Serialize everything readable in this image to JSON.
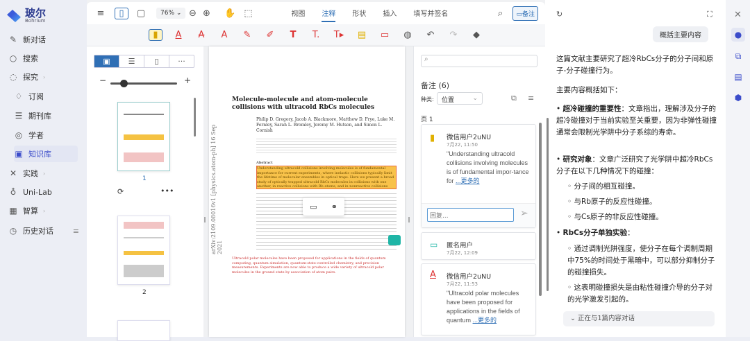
{
  "brand": {
    "name": "玻尔",
    "sub": "Bohrium"
  },
  "sidebar": {
    "items": [
      {
        "label": "新对话",
        "icon": "edit-icon"
      },
      {
        "label": "搜索",
        "icon": "search-icon"
      },
      {
        "label": "探究",
        "icon": "planet-icon"
      },
      {
        "label": "订阅",
        "icon": "bell-icon"
      },
      {
        "label": "期刊库",
        "icon": "journal-icon"
      },
      {
        "label": "学者",
        "icon": "scholar-icon"
      },
      {
        "label": "知识库",
        "icon": "book-icon"
      },
      {
        "label": "实践",
        "icon": "tools-icon"
      },
      {
        "label": "Uni-Lab",
        "icon": "lab-icon"
      },
      {
        "label": "智算",
        "icon": "compute-icon"
      },
      {
        "label": "历史对话",
        "icon": "history-icon"
      }
    ]
  },
  "toolbar": {
    "zoom": "76%",
    "tabs": [
      "视图",
      "注释",
      "形状",
      "插入",
      "填写并签名"
    ],
    "active_tab": "注释",
    "notes_button": "备注"
  },
  "thumbs": {
    "pages": [
      "1",
      "2"
    ]
  },
  "doc": {
    "title": "Molecule-molecule and atom-molecule collisions with ultracold RbCs molecules",
    "authors": "Philip D. Gregory, Jacob A. Blackmore, Matthew D. Frye, Luke M. Fernley, Sarah L. Bromley, Jeremy M. Hutson, and Simon L. Cornish",
    "arxiv": "arXiv:2109.08016v1 [physics.atom-ph] 16 Sep 2021",
    "abstract_label": "Abstract",
    "highlight": "Understanding ultracold collisions involving molecules is of fundamental importance for current experiments, where inelastic collisions typically limit the lifetime of molecular ensembles in optical traps. Here we present a broad study of optically trapped ultracold RbCs molecules in collisions with one another, in reactive collisions with Rb atoms, and in nonreactive collisions with Cs atoms.",
    "body": "Ultracold polar molecules have been proposed for applications in the fields of quantum computing, quantum simulation, quantum-state-controlled chemistry, and precision measurements. Experiments are now able to produce a wide variety of ultracold polar molecules in the ground state by association of atom pairs."
  },
  "annotations": {
    "search_placeholder": "",
    "title": "备注 (6)",
    "type_label": "种类:",
    "type_value": "位置",
    "page_label": "页 1",
    "reply_placeholder": "回复...",
    "items": [
      {
        "user": "微信用户2uNU",
        "time": "7月22, 11:50",
        "quote": "\"Understanding ultracold collisions involving molecules is of fundamental impor-tance for",
        "more": "...更多的"
      },
      {
        "user": "匿名用户",
        "time": "7月22, 12:09"
      },
      {
        "user": "微信用户2uNU",
        "time": "7月22, 11:53",
        "quote": "\"Ultracold polar molecules have been proposed for applications in the fields of quantum",
        "more": "...更多的"
      }
    ]
  },
  "ai": {
    "user_msg": "概括主要内容",
    "p1": "这篇文献主要研究了超冷RbCs分子的分子间和原子-分子碰撞行为。",
    "p2": "主要内容概括如下：",
    "b1_title": "超冷碰撞的重要性",
    "b1": "：文章指出，理解涉及分子的超冷碰撞对于当前实验至关重要，因为非弹性碰撞通常会限制光学阱中分子系综的寿命。",
    "b2_title": "研究对象",
    "b2": "：文章广泛研究了光学阱中超冷RbCs分子在以下几种情况下的碰撞：",
    "b2_sub": [
      "分子间的相互碰撞。",
      "与Rb原子的反应性碰撞。",
      "与Cs原子的非反应性碰撞。"
    ],
    "b3_title": "RbCs分子单独实验",
    "b3": "：",
    "b3_sub": [
      "通过调制光阱强度，使分子在每个调制周期中75%的时间处于黑暗中，可以部分抑制分子的碰撞损失。",
      "这表明碰撞损失是由粘性碰撞介导的分子对的光学激发引起的。"
    ],
    "context": "正在与1篇内容对话"
  }
}
